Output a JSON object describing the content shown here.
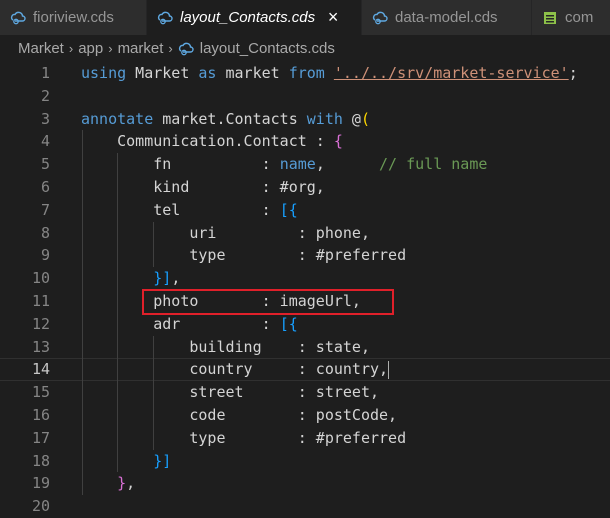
{
  "tabs": [
    {
      "label": "fioriview.cds",
      "icon": "cds-file-icon",
      "active": false
    },
    {
      "label": "layout_Contacts.cds",
      "icon": "cds-file-icon",
      "active": true
    },
    {
      "label": "data-model.cds",
      "icon": "cds-file-icon",
      "active": false
    },
    {
      "label": "com",
      "icon": "table-icon",
      "active": false
    }
  ],
  "tab_close": "×",
  "breadcrumb": [
    "Market",
    "app",
    "market",
    "layout_Contacts.cds"
  ],
  "breadcrumb_sep": "›",
  "lines": [
    {
      "n": "1",
      "t": [
        [
          "kw",
          "using"
        ],
        [
          "id",
          " Market "
        ],
        [
          "kw",
          "as"
        ],
        [
          "id",
          " market "
        ],
        [
          "kw",
          "from"
        ],
        [
          "id",
          " "
        ],
        [
          "str",
          "'../../srv/market-service'"
        ],
        [
          "id",
          ";"
        ]
      ]
    },
    {
      "n": "2",
      "t": []
    },
    {
      "n": "3",
      "t": [
        [
          "kw",
          "annotate"
        ],
        [
          "id",
          " market.Contacts "
        ],
        [
          "kw",
          "with"
        ],
        [
          "id",
          " @"
        ],
        [
          "brk-y",
          "("
        ]
      ]
    },
    {
      "n": "4",
      "t": [
        [
          "id",
          "    Communication.Contact : "
        ],
        [
          "brk-p",
          "{"
        ]
      ]
    },
    {
      "n": "5",
      "t": [
        [
          "id",
          "        fn          : "
        ],
        [
          "kw",
          "name"
        ],
        [
          "id",
          ",      "
        ],
        [
          "cmt",
          "// full name"
        ]
      ]
    },
    {
      "n": "6",
      "t": [
        [
          "id",
          "        kind        : #org,"
        ]
      ]
    },
    {
      "n": "7",
      "t": [
        [
          "id",
          "        tel         : "
        ],
        [
          "brk-b",
          "[{"
        ]
      ]
    },
    {
      "n": "8",
      "t": [
        [
          "id",
          "            uri         : phone,"
        ]
      ]
    },
    {
      "n": "9",
      "t": [
        [
          "id",
          "            type        : #preferred"
        ]
      ]
    },
    {
      "n": "10",
      "t": [
        [
          "id",
          "        "
        ],
        [
          "brk-b",
          "}]"
        ],
        [
          "id",
          ","
        ]
      ]
    },
    {
      "n": "11",
      "t": [
        [
          "id",
          "        photo       : imageUrl,"
        ]
      ]
    },
    {
      "n": "12",
      "t": [
        [
          "id",
          "        adr         : "
        ],
        [
          "brk-b",
          "[{"
        ]
      ]
    },
    {
      "n": "13",
      "t": [
        [
          "id",
          "            building    : state,"
        ]
      ]
    },
    {
      "n": "14",
      "t": [
        [
          "id",
          "            country     : country,"
        ]
      ]
    },
    {
      "n": "15",
      "t": [
        [
          "id",
          "            street      : street,"
        ]
      ]
    },
    {
      "n": "16",
      "t": [
        [
          "id",
          "            code        : postCode,"
        ]
      ]
    },
    {
      "n": "17",
      "t": [
        [
          "id",
          "            type        : #preferred"
        ]
      ]
    },
    {
      "n": "18",
      "t": [
        [
          "id",
          "        "
        ],
        [
          "brk-b",
          "}]"
        ]
      ]
    },
    {
      "n": "19",
      "t": [
        [
          "id",
          "    "
        ],
        [
          "brk-p",
          "}"
        ],
        [
          "id",
          ","
        ]
      ]
    },
    {
      "n": "20",
      "t": []
    }
  ],
  "current_line": "14",
  "highlight_line": "11"
}
